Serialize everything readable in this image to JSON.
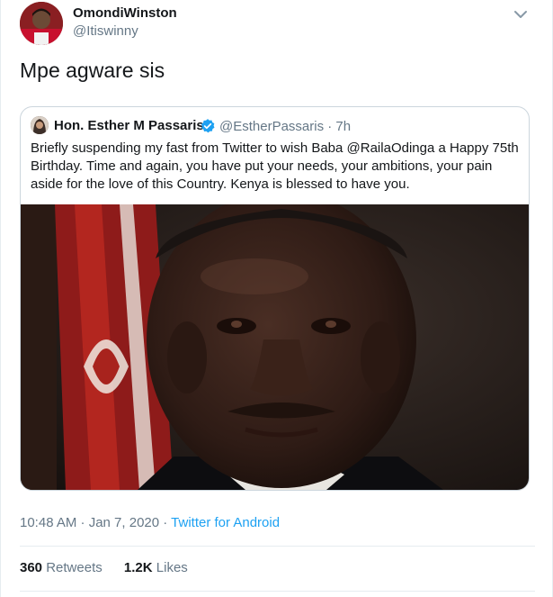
{
  "tweet": {
    "author_name": "OmondiWinston",
    "author_handle": "@Itiswinny",
    "text": "Mpe agware sis",
    "timestamp": "10:48 AM · Jan 7, 2020 · ",
    "source": "Twitter for Android"
  },
  "quoted_tweet": {
    "author_name": "Hon. Esther M Passaris",
    "author_handle": "@EstherPassaris · 7h",
    "verified": true,
    "text": "Briefly suspending my fast from Twitter to wish Baba @RailaOdinga a Happy 75th Birthday. Time and again, you have put your needs, your ambitions, your pain aside for the love of this Country. Kenya is blessed to have you."
  },
  "stats": {
    "retweets_count": "360",
    "retweets_label": "Retweets",
    "likes_count": "1.2K",
    "likes_label": "Likes"
  },
  "colors": {
    "link": "#1da1f2",
    "secondary_text": "#657786",
    "border": "#ccd6dd",
    "verified_badge": "#1da1f2"
  },
  "icons": {
    "caret": "chevron-down-icon",
    "verified": "verified-badge-icon"
  }
}
